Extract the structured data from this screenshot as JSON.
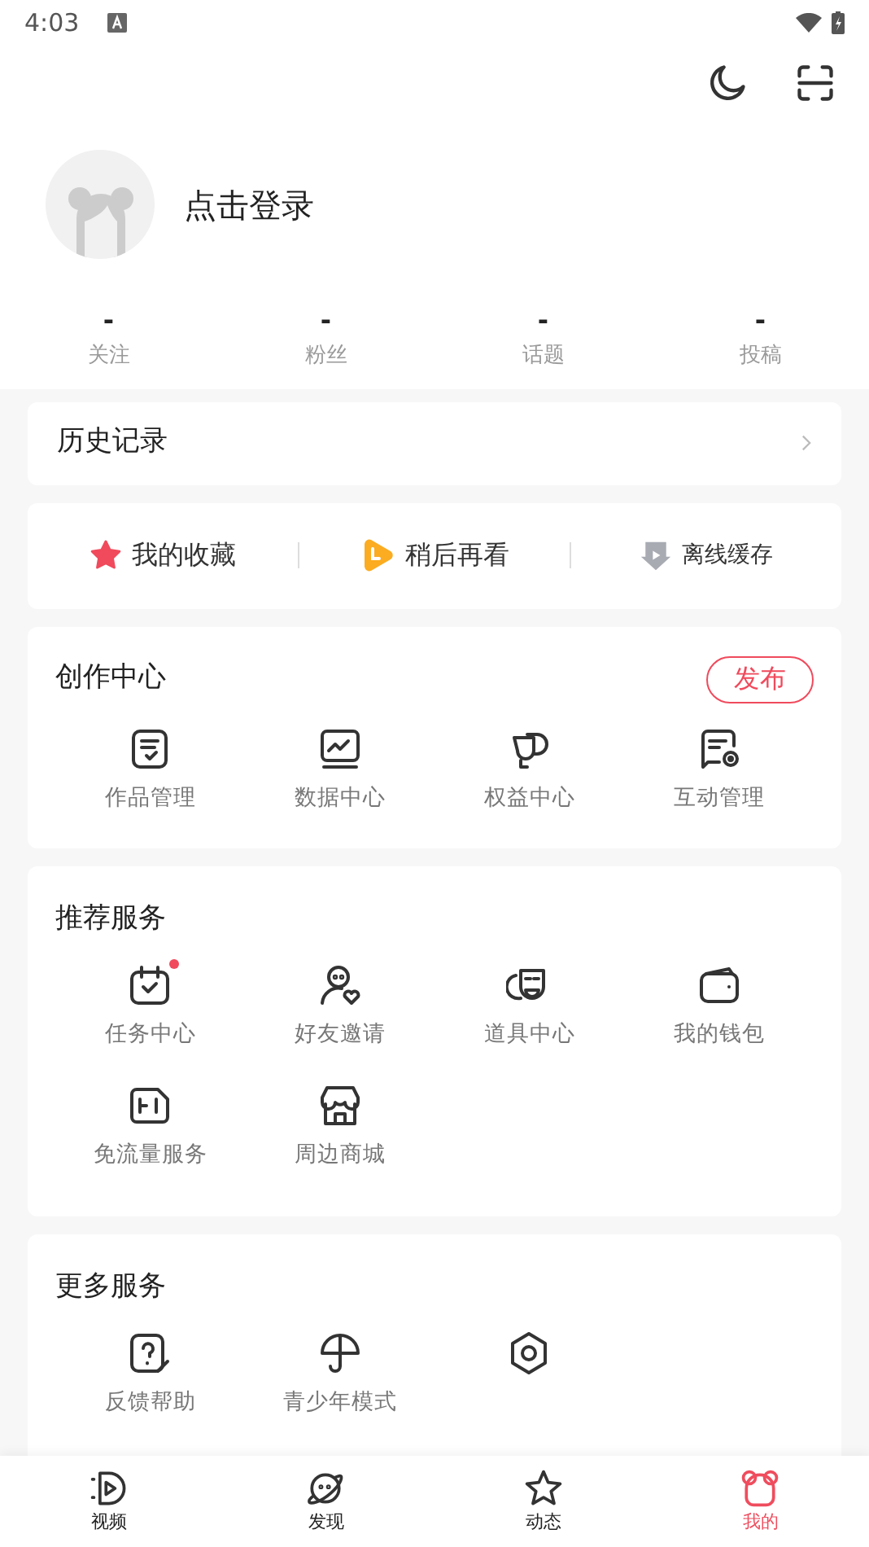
{
  "status_bar": {
    "time": "4:03"
  },
  "profile": {
    "login_text": "点击登录"
  },
  "stats": [
    {
      "value": "-",
      "label": "关注"
    },
    {
      "value": "-",
      "label": "粉丝"
    },
    {
      "value": "-",
      "label": "话题"
    },
    {
      "value": "-",
      "label": "投稿"
    }
  ],
  "history": {
    "title": "历史记录"
  },
  "quick_links": [
    {
      "kind": "star",
      "label": "我的收藏"
    },
    {
      "kind": "later",
      "label": "稍后再看"
    },
    {
      "kind": "offline",
      "label": "离线缓存"
    }
  ],
  "creation_center": {
    "title": "创作中心",
    "publish_button": "发布",
    "items": [
      {
        "kind": "works",
        "label": "作品管理"
      },
      {
        "kind": "data",
        "label": "数据中心"
      },
      {
        "kind": "rights",
        "label": "权益中心"
      },
      {
        "kind": "interact",
        "label": "互动管理"
      }
    ]
  },
  "recommended": {
    "title": "推荐服务",
    "items": [
      {
        "kind": "task",
        "label": "任务中心",
        "badge": true
      },
      {
        "kind": "invite",
        "label": "好友邀请",
        "badge": false
      },
      {
        "kind": "props",
        "label": "道具中心",
        "badge": false
      },
      {
        "kind": "wallet",
        "label": "我的钱包",
        "badge": false
      },
      {
        "kind": "traffic",
        "label": "免流量服务",
        "badge": false
      },
      {
        "kind": "shop",
        "label": "周边商城",
        "badge": false
      }
    ]
  },
  "more_services": {
    "title": "更多服务",
    "items": [
      {
        "kind": "help",
        "label": "反馈帮助"
      },
      {
        "kind": "youth",
        "label": "青少年模式"
      },
      {
        "kind": "settings"
      }
    ]
  },
  "bottom_nav": [
    {
      "kind": "video",
      "label": "视频",
      "selected": false
    },
    {
      "kind": "discover",
      "label": "发现",
      "selected": false
    },
    {
      "kind": "feed",
      "label": "动态",
      "selected": false
    },
    {
      "kind": "me",
      "label": "我的",
      "selected": true
    }
  ]
}
